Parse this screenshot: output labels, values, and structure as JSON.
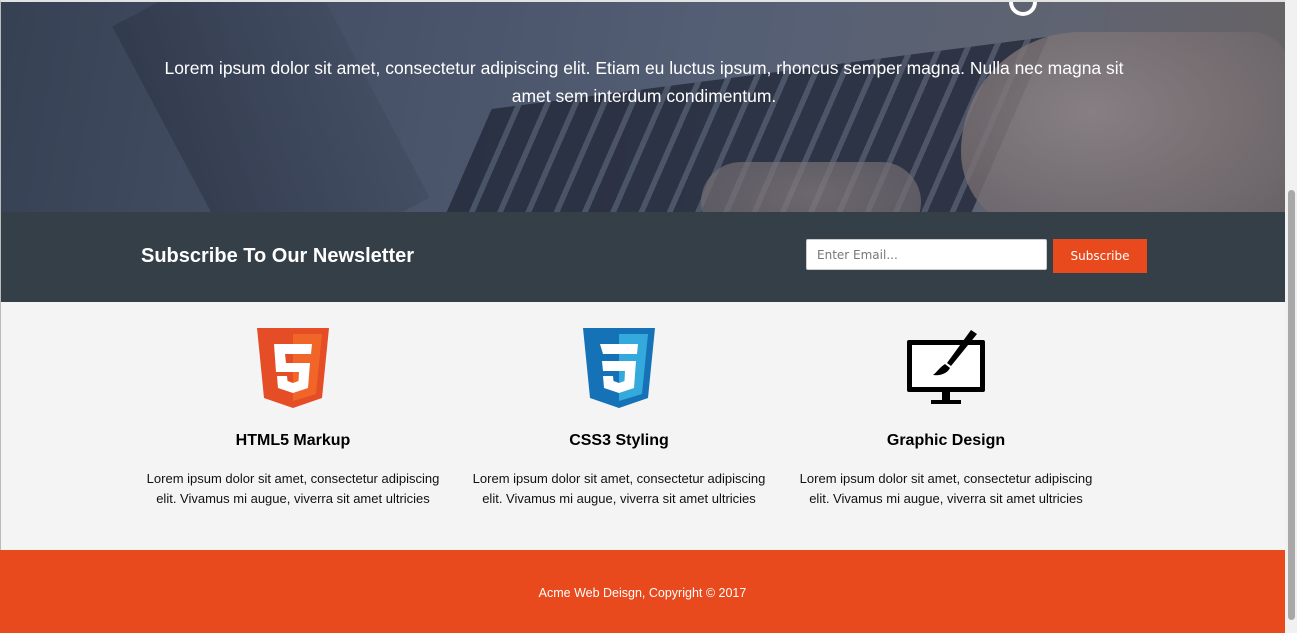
{
  "showcase": {
    "tagline": "Lorem ipsum dolor sit amet, consectetur adipiscing elit. Etiam eu luctus ipsum, rhoncus semper magna. Nulla nec magna sit amet sem interdum condimentum."
  },
  "newsletter": {
    "title": "Subscribe To Our Newsletter",
    "email_placeholder": "Enter Email...",
    "email_value": "",
    "button_label": "Subscribe"
  },
  "boxes": [
    {
      "icon": "html5-icon",
      "title": "HTML5 Markup",
      "text": "Lorem ipsum dolor sit amet, consectetur adipiscing elit. Vivamus mi augue, viverra sit amet ultricies"
    },
    {
      "icon": "css3-icon",
      "title": "CSS3 Styling",
      "text": "Lorem ipsum dolor sit amet, consectetur adipiscing elit. Vivamus mi augue, viverra sit amet ultricies"
    },
    {
      "icon": "graphic-design-icon",
      "title": "Graphic Design",
      "text": "Lorem ipsum dolor sit amet, consectetur adipiscing elit. Vivamus mi augue, viverra sit amet ultricies"
    }
  ],
  "footer": {
    "copyright": "Acme Web Deisgn, Copyright © 2017"
  },
  "colors": {
    "accent": "#e8491d",
    "newsletter_bg": "#353f48",
    "boxes_bg": "#f4f4f4"
  }
}
